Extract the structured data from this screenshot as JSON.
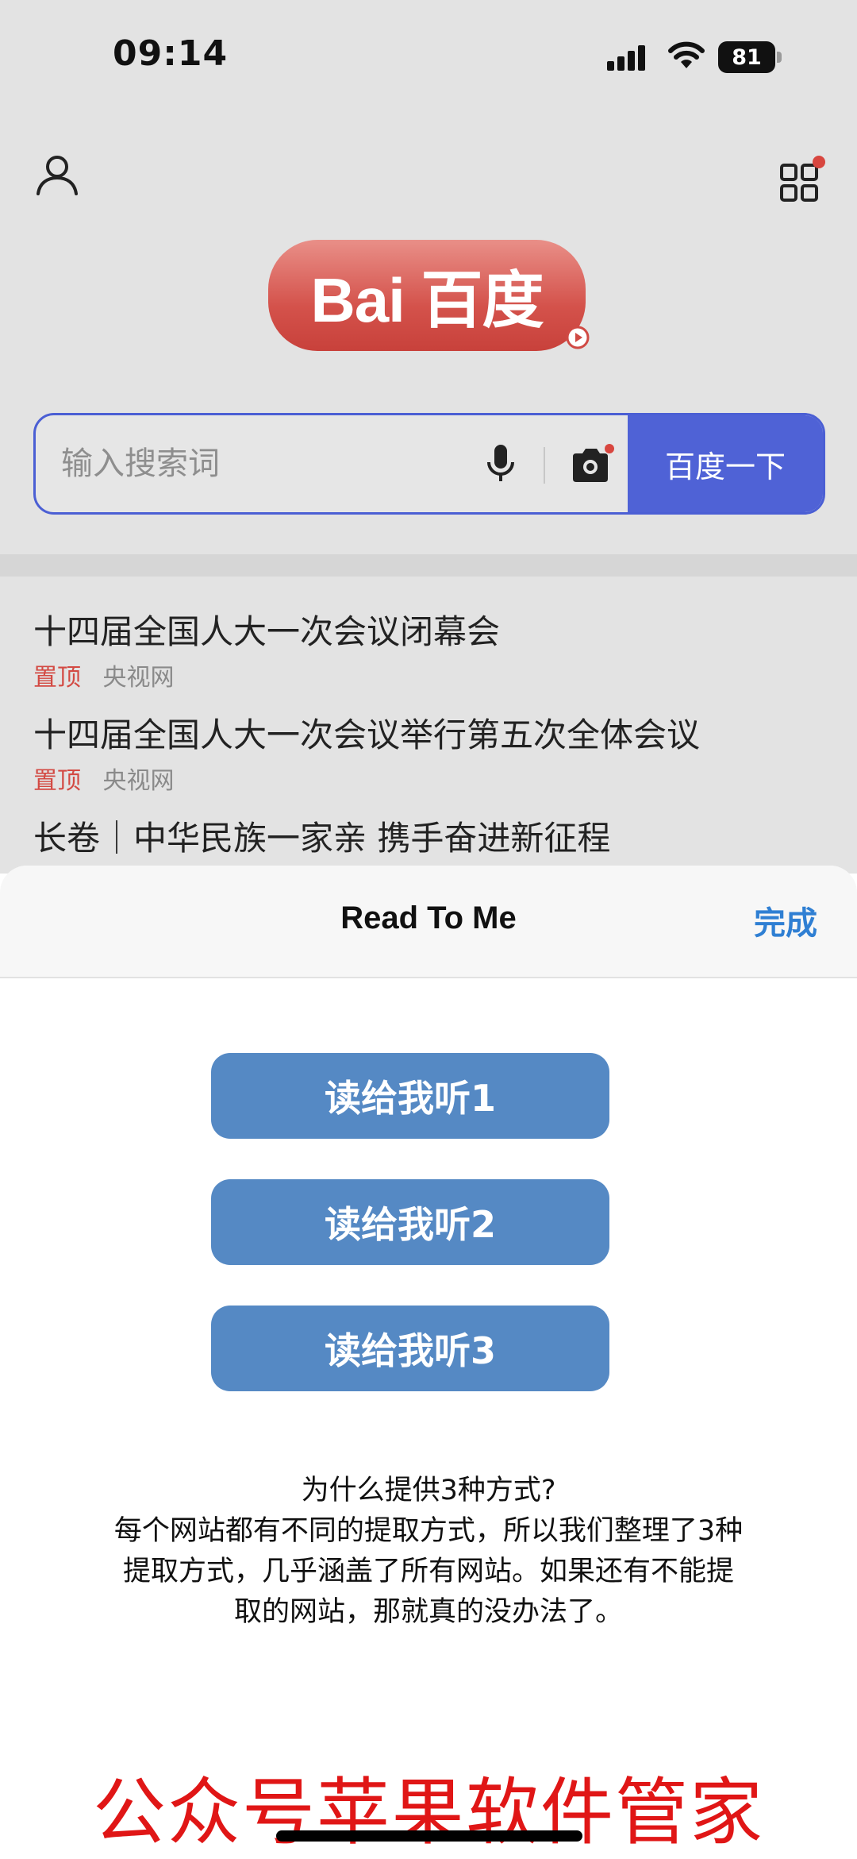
{
  "status_bar": {
    "time": "09:14",
    "battery": "81"
  },
  "colors": {
    "brand_blue": "#4f62d6",
    "accent_red": "#d34a43",
    "sheet_button_blue": "#5589c4",
    "done_blue": "#2f7fd3",
    "watermark_red": "#e01616"
  },
  "header": {
    "user_icon": "user-icon",
    "apps_icon": "apps-grid-icon",
    "logo_text": "Bai 百度"
  },
  "search": {
    "placeholder": "输入搜索词",
    "mic_icon": "microphone-icon",
    "camera_icon": "camera-icon",
    "button_label": "百度一下"
  },
  "news": [
    {
      "title": "十四届全国人大一次会议闭幕会",
      "tag": "置顶",
      "source": "央视网"
    },
    {
      "title": "十四届全国人大一次会议举行第五次全体会议",
      "tag": "置顶",
      "source": "央视网"
    },
    {
      "title": "长卷｜中华民族一家亲 携手奋进新征程"
    }
  ],
  "sheet": {
    "title": "Read To Me",
    "done_label": "完成",
    "buttons": [
      "读给我听1",
      "读给我听2",
      "读给我听3"
    ],
    "info_lines": [
      "为什么提供3种方式?",
      "每个网站都有不同的提取方式，所以我们整理了3种",
      "提取方式，几乎涵盖了所有网站。如果还有不能提",
      "取的网站，那就真的没办法了。"
    ]
  },
  "watermark": "公众号苹果软件管家"
}
